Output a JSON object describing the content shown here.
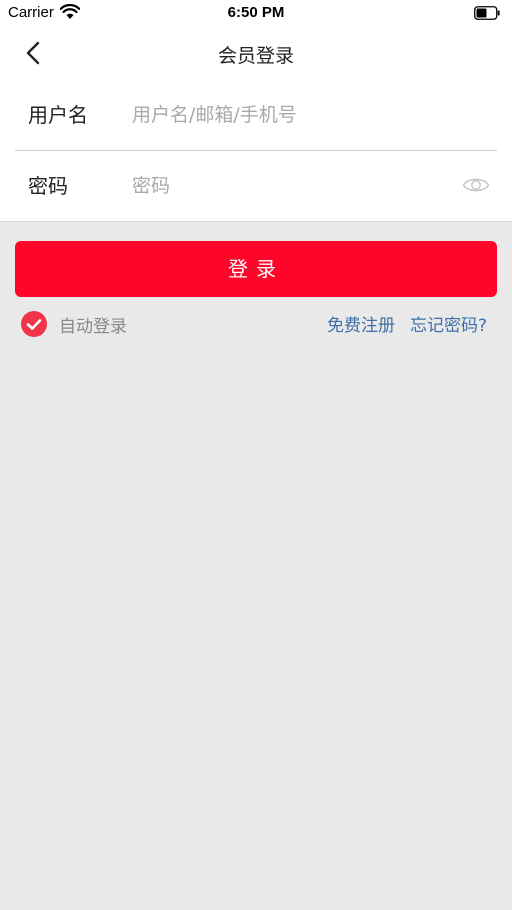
{
  "status_bar": {
    "carrier": "Carrier",
    "time": "6:50 PM"
  },
  "nav": {
    "title": "会员登录"
  },
  "form": {
    "username_label": "用户名",
    "username_placeholder": "用户名/邮箱/手机号",
    "username_value": "",
    "password_label": "密码",
    "password_placeholder": "密码",
    "password_value": ""
  },
  "login_button_label": "登录",
  "auto_login": {
    "label": "自动登录",
    "checked": true
  },
  "links": {
    "register": "免费注册",
    "forgot_password": "忘记密码?"
  },
  "colors": {
    "accent": "#ff0529",
    "link": "#3e6fa8",
    "background": "#e9e9e9"
  }
}
